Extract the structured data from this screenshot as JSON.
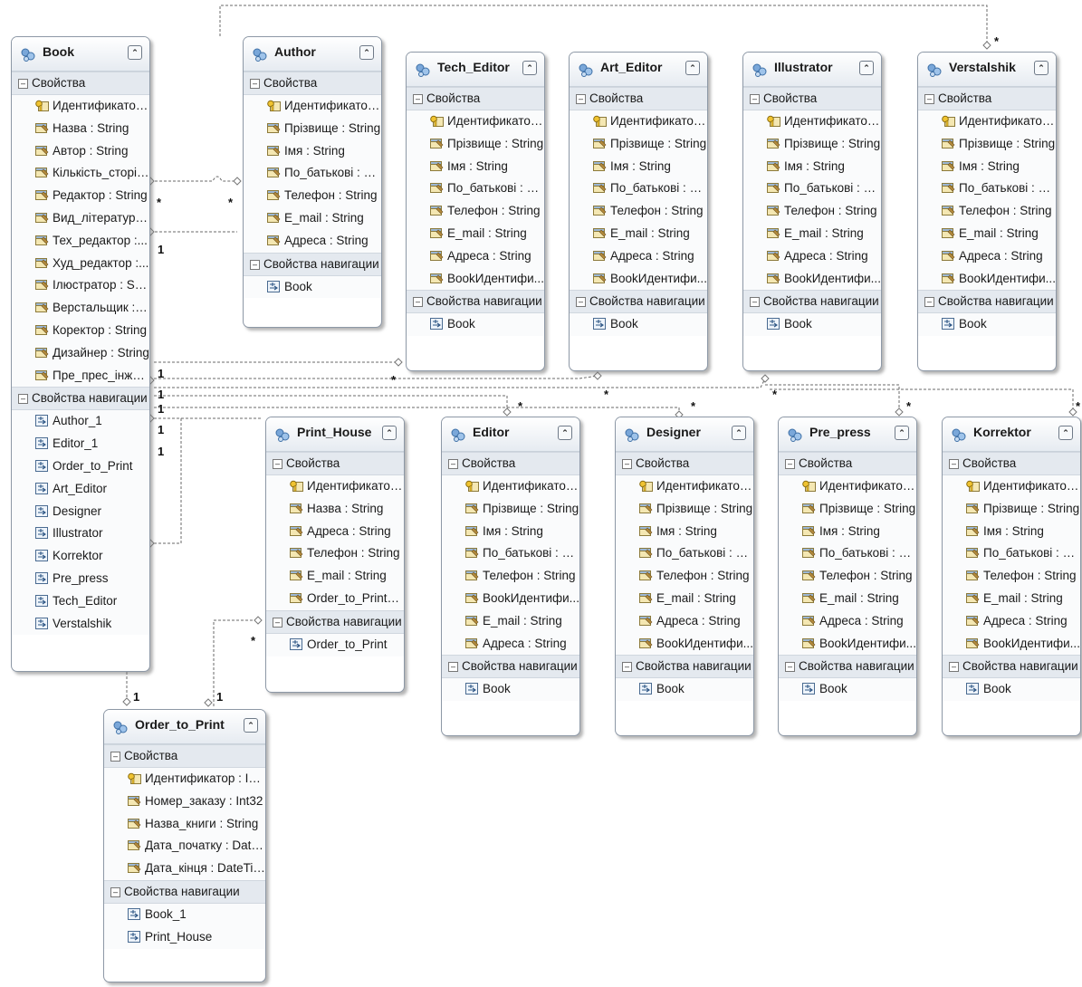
{
  "section_properties": "Свойства",
  "section_navigation": "Свойства навигации",
  "entities": {
    "book": {
      "title": "Book",
      "props": [
        "Идентификатор...",
        "Назва : String",
        "Автор : String",
        "Кількість_сторін...",
        "Редактор : String",
        "Вид_літератури...",
        "Тех_редактор :...",
        "Худ_редактор :...",
        "Ілюстратор : Str...",
        "Верстальщик : S...",
        "Коректор : String",
        "Дизайнер : String",
        "Пре_прес_інже..."
      ],
      "navs": [
        "Author_1",
        "Editor_1",
        "Order_to_Print",
        "Art_Editor",
        "Designer",
        "Illustrator",
        "Korrektor",
        "Pre_press",
        "Tech_Editor",
        "Verstalshik"
      ]
    },
    "author": {
      "title": "Author",
      "props": [
        "Идентификатор...",
        "Прізвище : String",
        "Імя : String",
        "По_батькові : St...",
        "Телефон : String",
        "E_mail : String",
        "Адреса : String"
      ],
      "navs": [
        "Book"
      ]
    },
    "tech_editor": {
      "title": "Tech_Editor",
      "props": [
        "Идентификатор...",
        "Прізвище : String",
        "Імя : String",
        "По_батькові : St...",
        "Телефон : String",
        "E_mail : String",
        "Адреса : String",
        "BookИдентифи..."
      ],
      "navs": [
        "Book"
      ]
    },
    "art_editor": {
      "title": "Art_Editor",
      "props": [
        "Идентификатор...",
        "Прізвище : String",
        "Імя : String",
        "По_батькові : St...",
        "Телефон : String",
        "E_mail : String",
        "Адреса : String",
        "BookИдентифи..."
      ],
      "navs": [
        "Book"
      ]
    },
    "illustrator": {
      "title": "Illustrator",
      "props": [
        "Идентификатор...",
        "Прізвище : String",
        "Імя : String",
        "По_батькові : St...",
        "Телефон : String",
        "E_mail : String",
        "Адреса : String",
        "BookИдентифи..."
      ],
      "navs": [
        "Book"
      ]
    },
    "verstalshik": {
      "title": "Verstalshik",
      "props": [
        "Идентификатор...",
        "Прізвище : String",
        "Імя : String",
        "По_батькові : St...",
        "Телефон : String",
        "E_mail : String",
        "Адреса : String",
        "BookИдентифи..."
      ],
      "navs": [
        "Book"
      ]
    },
    "print_house": {
      "title": "Print_House",
      "props": [
        "Идентификатор...",
        "Назва : String",
        "Адреса : String",
        "Телефон : String",
        "E_mail : String",
        "Order_to_PrintИ..."
      ],
      "navs": [
        "Order_to_Print"
      ]
    },
    "editor": {
      "title": "Editor",
      "props": [
        "Идентификатор...",
        "Прізвище : String",
        "Імя : String",
        "По_батькові : St...",
        "Телефон : String",
        "BookИдентифи...",
        "E_mail : String",
        "Адреса : String"
      ],
      "navs": [
        "Book"
      ]
    },
    "designer": {
      "title": "Designer",
      "props": [
        "Идентификатор...",
        "Прізвище : String",
        "Імя : String",
        "По_батькові : St...",
        "Телефон : String",
        "E_mail : String",
        "Адреса : String",
        "BookИдентифи..."
      ],
      "navs": [
        "Book"
      ]
    },
    "pre_press": {
      "title": "Pre_press",
      "props": [
        "Идентификатор...",
        "Прізвище : String",
        "Імя : String",
        "По_батькові : St...",
        "Телефон : String",
        "E_mail : String",
        "Адреса : String",
        "BookИдентифи..."
      ],
      "navs": [
        "Book"
      ]
    },
    "korrektor": {
      "title": "Korrektor",
      "props": [
        "Идентификатор...",
        "Прізвище : String",
        "Імя : String",
        "По_батькові : St...",
        "Телефон : String",
        "E_mail : String",
        "Адреса : String",
        "BookИдентифи..."
      ],
      "navs": [
        "Book"
      ]
    },
    "order_to_print": {
      "title": "Order_to_Print",
      "props": [
        "Идентификатор : Int...",
        "Номер_заказу : Int32",
        "Назва_книги : String",
        "Дата_початку : Date...",
        "Дата_кінця : DateTime"
      ],
      "navs": [
        "Book_1",
        "Print_House"
      ]
    }
  },
  "multiplicity_labels": [
    "*",
    "*",
    "1",
    "1",
    "1",
    "1",
    "1",
    "1",
    "*",
    "*",
    "*",
    "*",
    "*",
    "*",
    "*",
    "*",
    "1",
    "1",
    "*"
  ]
}
